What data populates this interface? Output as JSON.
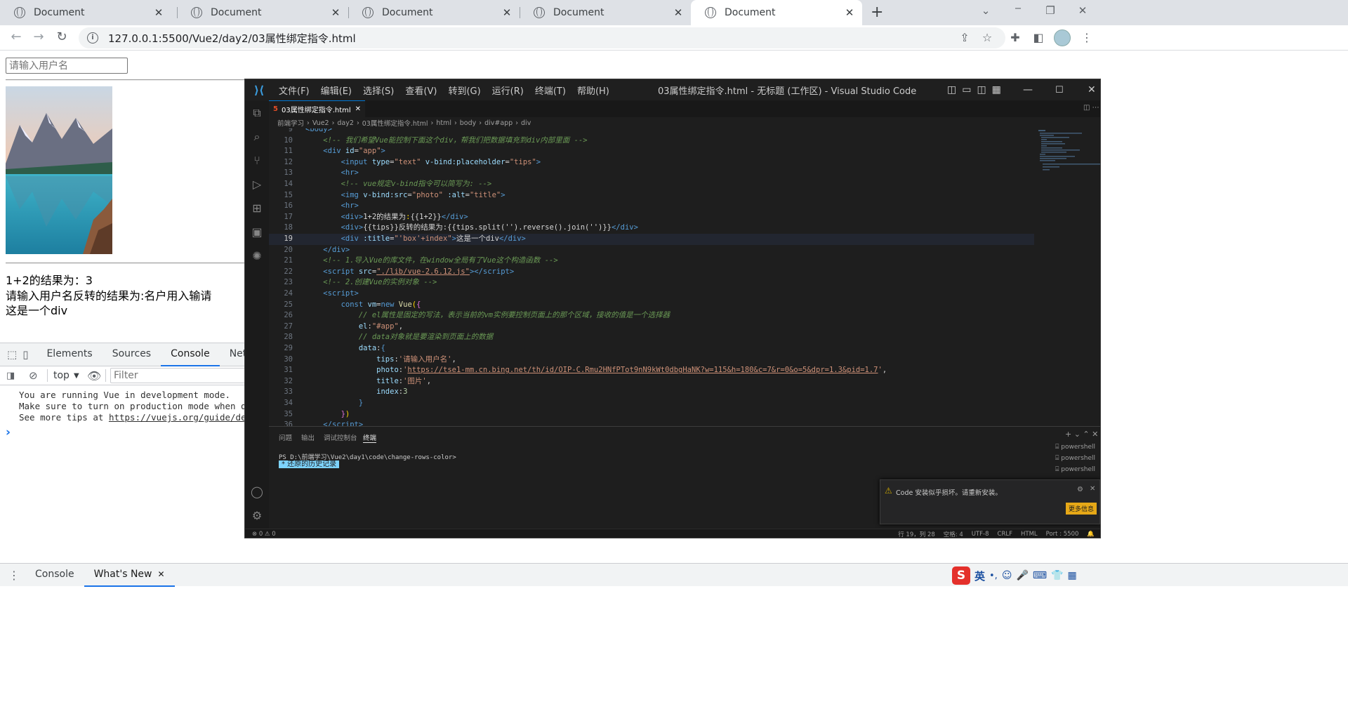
{
  "browser": {
    "tabs": [
      {
        "title": "Document",
        "active": false
      },
      {
        "title": "Document",
        "active": false
      },
      {
        "title": "Document",
        "active": false
      },
      {
        "title": "Document",
        "active": false
      },
      {
        "title": "Document",
        "active": true
      }
    ],
    "url": "127.0.0.1:5500/Vue2/day2/03属性绑定指令.html"
  },
  "page": {
    "input_placeholder": "请输入用户名",
    "line1": "1+2的结果为：3",
    "line2": "请输入用户名反转的结果为:名户用入输请",
    "line3": "这是一个div"
  },
  "devtools": {
    "tabs": [
      "Elements",
      "Sources",
      "Console",
      "Netw"
    ],
    "active_tab": "Console",
    "context": "top",
    "filter_placeholder": "Filter",
    "messages": [
      "You are running Vue in development mode.",
      "Make sure to turn on production mode when de",
      "See more tips at "
    ],
    "link": "https://vuejs.org/guide/dep",
    "prompt": "›",
    "drawer_tabs": [
      "Console",
      "What's New"
    ]
  },
  "vscode": {
    "menus": [
      "文件(F)",
      "编辑(E)",
      "选择(S)",
      "查看(V)",
      "转到(G)",
      "运行(R)",
      "终端(T)",
      "帮助(H)"
    ],
    "window_title": "03属性绑定指令.html - 无标题 (工作区) - Visual Studio Code",
    "tab": "03属性绑定指令.html",
    "breadcrumb": [
      "前端学习",
      "Vue2",
      "day2",
      "03属性绑定指令.html",
      "html",
      "body",
      "div#app",
      "div"
    ],
    "panel_tabs": [
      "问题",
      "输出",
      "调试控制台",
      "终端"
    ],
    "active_panel": "终端",
    "terminal_line": "PS D:\\前端学习\\Vue2\\day1\\code\\change-rows-color>",
    "history_label": "*  还原的历史记录",
    "shells": [
      "powershell",
      "powershell",
      "powershell"
    ],
    "notification": "Code 安装似乎损坏。请重新安装。",
    "notification_button": "更多信息",
    "status_left": "⊗ 0 ⚠ 0",
    "status_items": [
      "行 19，列 28",
      "空格: 4",
      "UTF-8",
      "CRLF",
      "HTML",
      "Port : 5500"
    ],
    "code_lines": [
      {
        "n": "9",
        "html": "<span class='tg'>&lt;body&gt;</span>"
      },
      {
        "n": "10",
        "html": "    <span class='cm'>&lt;!-- 我们希望Vue能控制下面这个div，帮我们把数据填充到div内部里面 --&gt;</span>"
      },
      {
        "n": "11",
        "html": "    <span class='tg'>&lt;div</span> <span class='at'>id</span><span class='tx'>=</span><span class='st'>\"app\"</span><span class='tg'>&gt;</span>"
      },
      {
        "n": "12",
        "html": "        <span class='tg'>&lt;input</span> <span class='at'>type</span><span class='tx'>=</span><span class='st'>\"text\"</span> <span class='at'>v-bind:placeholder</span><span class='tx'>=</span><span class='st'>\"tips\"</span><span class='tg'>&gt;</span>"
      },
      {
        "n": "13",
        "html": "        <span class='tg'>&lt;hr&gt;</span>"
      },
      {
        "n": "14",
        "html": "        <span class='cm'>&lt;!-- vue规定v-bind指令可以简写为: --&gt;</span>"
      },
      {
        "n": "15",
        "html": "        <span class='tg'>&lt;img</span> <span class='at'>v-bind:src</span><span class='tx'>=</span><span class='st'>\"photo\"</span> <span class='at'>:alt</span><span class='tx'>=</span><span class='st'>\"title\"</span><span class='tg'>&gt;</span>"
      },
      {
        "n": "16",
        "html": "        <span class='tg'>&lt;hr&gt;</span>"
      },
      {
        "n": "17",
        "html": "        <span class='tg'>&lt;div&gt;</span><span class='tx'>1+2的结果为</span><span class='br'>:</span><span class='tx'>{{1+2}}</span><span class='tg'>&lt;/div&gt;</span>"
      },
      {
        "n": "18",
        "html": "        <span class='tg'>&lt;div&gt;</span><span class='tx'>{{tips}}反转的结果为:{{tips.split('').reverse().join('')}}</span><span class='tg'>&lt;/div&gt;</span>"
      },
      {
        "n": "19",
        "html": "        <span class='tg'>&lt;div</span> <span class='at'>:title</span><span class='tx'>=</span><span class='st'>\"'box'+index\"</span><span class='tg'>&gt;</span><span class='tx'>这是一个div</span><span class='tg'>&lt;/div&gt;</span>",
        "cur": true
      },
      {
        "n": "20",
        "html": "    <span class='tg'>&lt;/div&gt;</span>"
      },
      {
        "n": "21",
        "html": "    <span class='cm'>&lt;!-- 1.导入Vue的库文件，在window全局有了Vue这个构造函数 --&gt;</span>"
      },
      {
        "n": "22",
        "html": "    <span class='tg'>&lt;script</span> <span class='at'>src</span><span class='tx'>=</span><span class='st' style='text-decoration:underline'>\"./lib/vue-2.6.12.js\"</span><span class='tg'>&gt;&lt;/script&gt;</span>"
      },
      {
        "n": "23",
        "html": "    <span class='cm'>&lt;!-- 2.创建Vue的实例对象 --&gt;</span>"
      },
      {
        "n": "24",
        "html": "    <span class='tg'>&lt;script&gt;</span>"
      },
      {
        "n": "25",
        "html": "        <span class='kw'>const</span> <span class='pr'>vm</span><span class='tx'>=</span><span class='kw'>new</span> <span class='fn'>Vue</span><span class='br'>(</span><span class='pp'>{</span>"
      },
      {
        "n": "26",
        "html": "            <span class='cm'>// el属性是固定的写法，表示当前的vm实例要控制页面上的那个区域，接收的值是一个选择器</span>"
      },
      {
        "n": "27",
        "html": "            <span class='pr'>el</span><span class='tx'>:</span><span class='st'>\"#app\"</span><span class='tx'>,</span>"
      },
      {
        "n": "28",
        "html": "            <span class='cm'>// data对象就是要渲染到页面上的数据</span>"
      },
      {
        "n": "29",
        "html": "            <span class='pr'>data</span><span class='tx'>:</span><span class='kw'>{</span>"
      },
      {
        "n": "30",
        "html": "                <span class='pr'>tips</span><span class='tx'>:</span><span class='st'>'请输入用户名'</span><span class='tx'>,</span>"
      },
      {
        "n": "31",
        "html": "                <span class='pr'>photo</span><span class='tx'>:</span><span class='st'>'</span><span class='lk'>https://tse1-mm.cn.bing.net/th/id/OIP-C.Rmu2HNfPTot9nN9kWt0dbgHaNK?w=115&amp;h=180&amp;c=7&amp;r=0&amp;o=5&amp;dpr=1.3&amp;pid=1.7</span><span class='st'>'</span><span class='tx'>,</span>"
      },
      {
        "n": "32",
        "html": "                <span class='pr'>title</span><span class='tx'>:</span><span class='st'>'图片'</span><span class='tx'>,</span>"
      },
      {
        "n": "33",
        "html": "                <span class='pr'>index</span><span class='tx'>:</span><span class='nm'>3</span>"
      },
      {
        "n": "34",
        "html": "            <span class='kw'>}</span>"
      },
      {
        "n": "35",
        "html": "        <span class='pp'>}</span><span class='br'>)</span>"
      },
      {
        "n": "36",
        "html": "    <span class='tg'>&lt;/script&gt;</span>"
      }
    ]
  },
  "tray": {
    "ime_logo": "S",
    "ime_lang": "英"
  }
}
